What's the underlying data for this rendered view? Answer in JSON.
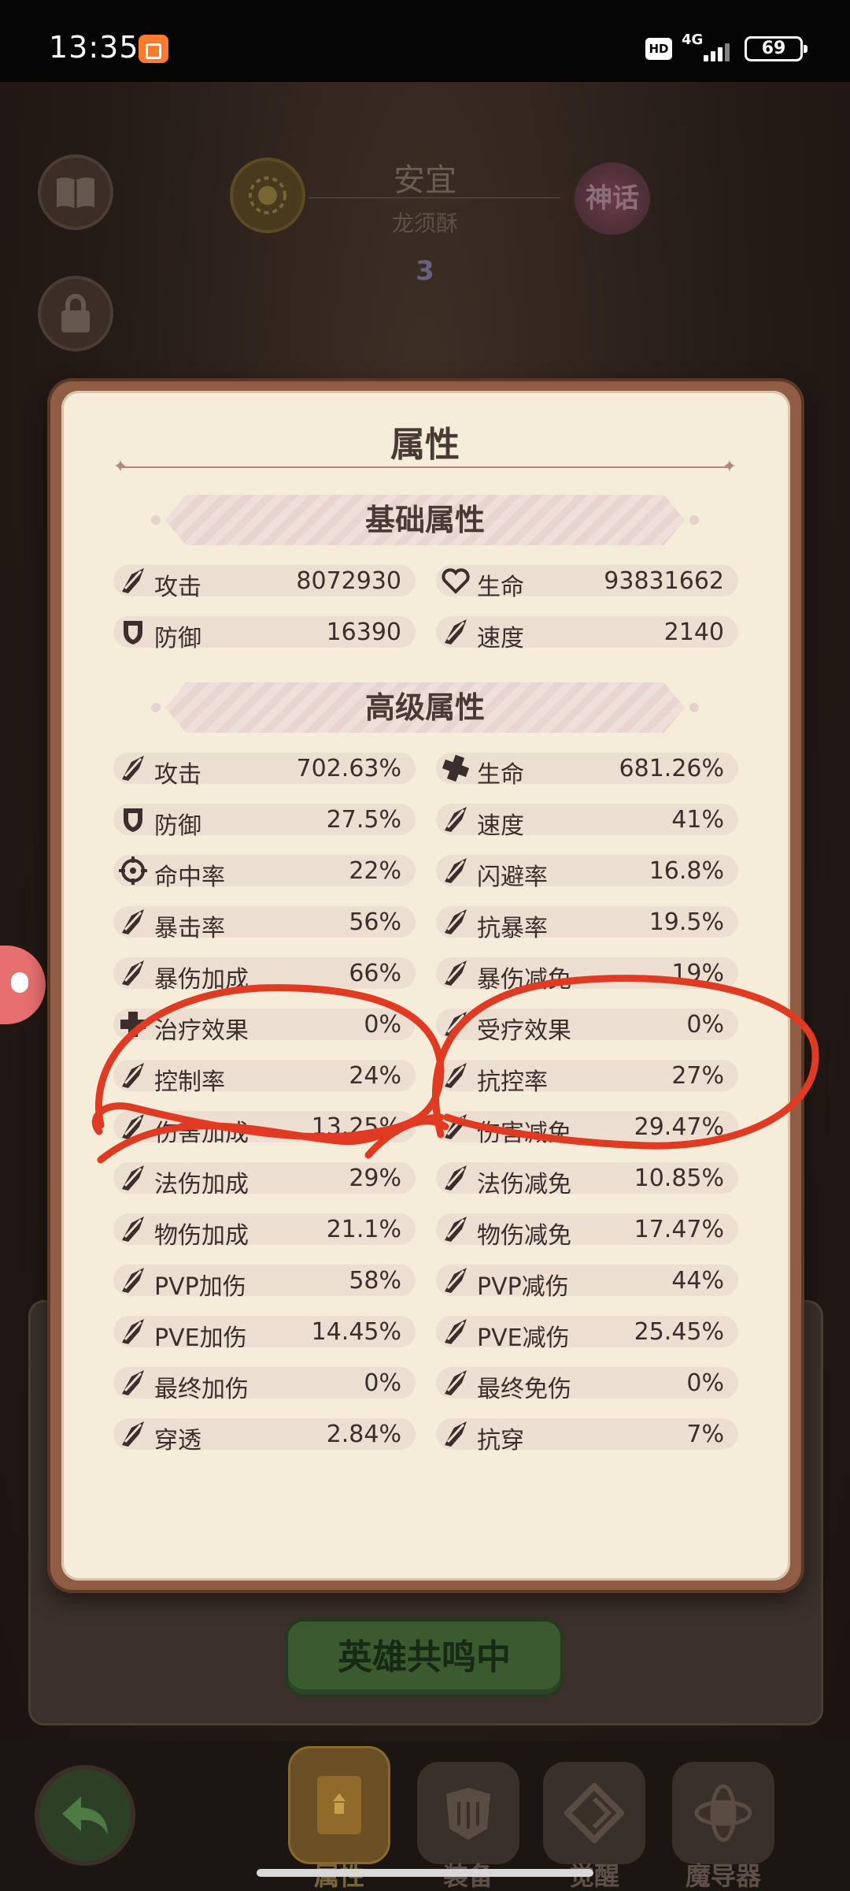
{
  "status_bar": {
    "time": "13:35",
    "hd": "HD",
    "network": "4G",
    "battery": "69"
  },
  "background": {
    "hero_name": "安宜",
    "hero_subtitle": "龙须酥",
    "rarity_badge": "神话",
    "star_level": "3"
  },
  "panel": {
    "title": "属性",
    "basic_section": {
      "title": "基础属性",
      "stats": [
        {
          "label": "攻击",
          "value": "8072930",
          "icon": "sword-slash-icon"
        },
        {
          "label": "生命",
          "value": "93831662",
          "icon": "heart-icon"
        },
        {
          "label": "防御",
          "value": "16390",
          "icon": "shield-icon"
        },
        {
          "label": "速度",
          "value": "2140",
          "icon": "boot-icon"
        }
      ]
    },
    "advanced_section": {
      "title": "高级属性",
      "stats": [
        {
          "label": "攻击",
          "value": "702.63%",
          "icon": "claw-slash-icon"
        },
        {
          "label": "生命",
          "value": "681.26%",
          "icon": "cross-heal-icon"
        },
        {
          "label": "防御",
          "value": "27.5%",
          "icon": "shield-icon"
        },
        {
          "label": "速度",
          "value": "41%",
          "icon": "wing-icon"
        },
        {
          "label": "命中率",
          "value": "22%",
          "icon": "crosshair-icon"
        },
        {
          "label": "闪避率",
          "value": "16.8%",
          "icon": "dodge-icon"
        },
        {
          "label": "暴击率",
          "value": "56%",
          "icon": "crit-icon"
        },
        {
          "label": "抗暴率",
          "value": "19.5%",
          "icon": "crit-resist-icon"
        },
        {
          "label": "暴伤加成",
          "value": "66%",
          "icon": "crit-damage-icon"
        },
        {
          "label": "暴伤减免",
          "value": "19%",
          "icon": "crit-damage-reduce-icon"
        },
        {
          "label": "治疗效果",
          "value": "0%",
          "icon": "plus-icon"
        },
        {
          "label": "受疗效果",
          "value": "0%",
          "icon": "heal-receive-icon"
        },
        {
          "label": "控制率",
          "value": "24%",
          "icon": "control-icon"
        },
        {
          "label": "抗控率",
          "value": "27%",
          "icon": "control-resist-icon"
        },
        {
          "label": "伤害加成",
          "value": "13.25%",
          "icon": "damage-up-icon"
        },
        {
          "label": "伤害减免",
          "value": "29.47%",
          "icon": "damage-reduce-icon"
        },
        {
          "label": "法伤加成",
          "value": "29%",
          "icon": "magic-damage-icon"
        },
        {
          "label": "法伤减免",
          "value": "10.85%",
          "icon": "magic-reduce-icon"
        },
        {
          "label": "物伤加成",
          "value": "21.1%",
          "icon": "physical-damage-icon"
        },
        {
          "label": "物伤减免",
          "value": "17.47%",
          "icon": "physical-reduce-icon"
        },
        {
          "label": "PVP加伤",
          "value": "58%",
          "icon": "pvp-damage-icon"
        },
        {
          "label": "PVP减伤",
          "value": "44%",
          "icon": "pvp-reduce-icon"
        },
        {
          "label": "PVE加伤",
          "value": "14.45%",
          "icon": "pve-damage-icon"
        },
        {
          "label": "PVE减伤",
          "value": "25.45%",
          "icon": "pve-reduce-icon"
        },
        {
          "label": "最终加伤",
          "value": "0%",
          "icon": "final-damage-icon"
        },
        {
          "label": "最终免伤",
          "value": "0%",
          "icon": "final-reduce-icon"
        },
        {
          "label": "穿透",
          "value": "2.84%",
          "icon": "penetrate-icon"
        },
        {
          "label": "抗穿",
          "value": "7%",
          "icon": "penetrate-resist-icon"
        }
      ]
    }
  },
  "bottom": {
    "resonate_button": "英雄共鸣中",
    "tabs": [
      {
        "label": "属性",
        "active": true,
        "icon": "book-icon"
      },
      {
        "label": "装备",
        "active": false,
        "icon": "armor-icon"
      },
      {
        "label": "觉醒",
        "active": false,
        "icon": "rune-icon"
      },
      {
        "label": "魔导器",
        "active": false,
        "icon": "orb-icon"
      }
    ]
  },
  "colors": {
    "panel_bg": "#f5ecd9",
    "row_bg": "#ecdfd2",
    "text": "#3a2f2c",
    "annotation_red": "#e03a22"
  }
}
